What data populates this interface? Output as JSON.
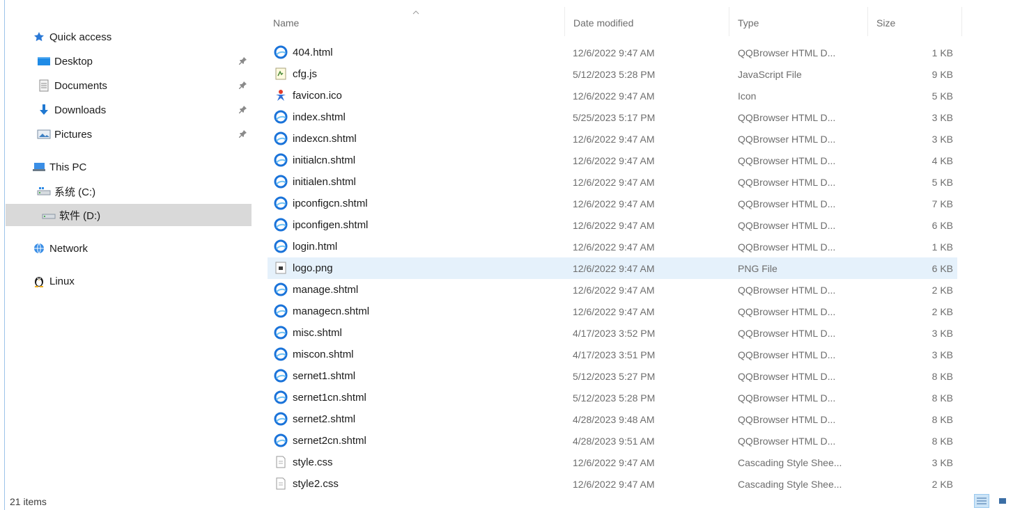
{
  "sidebar": {
    "quick_access": "Quick access",
    "items": [
      {
        "label": "Desktop",
        "icon": "desktop-icon"
      },
      {
        "label": "Documents",
        "icon": "documents-icon"
      },
      {
        "label": "Downloads",
        "icon": "downloads-icon"
      },
      {
        "label": "Pictures",
        "icon": "pictures-icon"
      }
    ],
    "this_pc": "This PC",
    "drive_c": "系统 (C:)",
    "drive_d": "软件 (D:)",
    "network": "Network",
    "linux": "Linux"
  },
  "columns": {
    "name": "Name",
    "date": "Date modified",
    "type": "Type",
    "size": "Size"
  },
  "files": [
    {
      "name": "404.html",
      "date": "12/6/2022 9:47 AM",
      "type": "QQBrowser HTML D...",
      "size": "1 KB",
      "icon": "qqbrowser-html-icon"
    },
    {
      "name": "cfg.js",
      "date": "5/12/2023 5:28 PM",
      "type": "JavaScript File",
      "size": "9 KB",
      "icon": "javascript-file-icon"
    },
    {
      "name": "favicon.ico",
      "date": "12/6/2022 9:47 AM",
      "type": "Icon",
      "size": "5 KB",
      "icon": "favicon-icon"
    },
    {
      "name": "index.shtml",
      "date": "5/25/2023 5:17 PM",
      "type": "QQBrowser HTML D...",
      "size": "3 KB",
      "icon": "qqbrowser-html-icon"
    },
    {
      "name": "indexcn.shtml",
      "date": "12/6/2022 9:47 AM",
      "type": "QQBrowser HTML D...",
      "size": "3 KB",
      "icon": "qqbrowser-html-icon"
    },
    {
      "name": "initialcn.shtml",
      "date": "12/6/2022 9:47 AM",
      "type": "QQBrowser HTML D...",
      "size": "4 KB",
      "icon": "qqbrowser-html-icon"
    },
    {
      "name": "initialen.shtml",
      "date": "12/6/2022 9:47 AM",
      "type": "QQBrowser HTML D...",
      "size": "5 KB",
      "icon": "qqbrowser-html-icon"
    },
    {
      "name": "ipconfigcn.shtml",
      "date": "12/6/2022 9:47 AM",
      "type": "QQBrowser HTML D...",
      "size": "7 KB",
      "icon": "qqbrowser-html-icon"
    },
    {
      "name": "ipconfigen.shtml",
      "date": "12/6/2022 9:47 AM",
      "type": "QQBrowser HTML D...",
      "size": "6 KB",
      "icon": "qqbrowser-html-icon"
    },
    {
      "name": "login.html",
      "date": "12/6/2022 9:47 AM",
      "type": "QQBrowser HTML D...",
      "size": "1 KB",
      "icon": "qqbrowser-html-icon"
    },
    {
      "name": "logo.png",
      "date": "12/6/2022 9:47 AM",
      "type": "PNG File",
      "size": "6 KB",
      "icon": "png-file-icon",
      "highlight": true
    },
    {
      "name": "manage.shtml",
      "date": "12/6/2022 9:47 AM",
      "type": "QQBrowser HTML D...",
      "size": "2 KB",
      "icon": "qqbrowser-html-icon"
    },
    {
      "name": "managecn.shtml",
      "date": "12/6/2022 9:47 AM",
      "type": "QQBrowser HTML D...",
      "size": "2 KB",
      "icon": "qqbrowser-html-icon"
    },
    {
      "name": "misc.shtml",
      "date": "4/17/2023 3:52 PM",
      "type": "QQBrowser HTML D...",
      "size": "3 KB",
      "icon": "qqbrowser-html-icon"
    },
    {
      "name": "miscon.shtml",
      "date": "4/17/2023 3:51 PM",
      "type": "QQBrowser HTML D...",
      "size": "3 KB",
      "icon": "qqbrowser-html-icon"
    },
    {
      "name": "sernet1.shtml",
      "date": "5/12/2023 5:27 PM",
      "type": "QQBrowser HTML D...",
      "size": "8 KB",
      "icon": "qqbrowser-html-icon"
    },
    {
      "name": "sernet1cn.shtml",
      "date": "5/12/2023 5:28 PM",
      "type": "QQBrowser HTML D...",
      "size": "8 KB",
      "icon": "qqbrowser-html-icon"
    },
    {
      "name": "sernet2.shtml",
      "date": "4/28/2023 9:48 AM",
      "type": "QQBrowser HTML D...",
      "size": "8 KB",
      "icon": "qqbrowser-html-icon"
    },
    {
      "name": "sernet2cn.shtml",
      "date": "4/28/2023 9:51 AM",
      "type": "QQBrowser HTML D...",
      "size": "8 KB",
      "icon": "qqbrowser-html-icon"
    },
    {
      "name": "style.css",
      "date": "12/6/2022 9:47 AM",
      "type": "Cascading Style Shee...",
      "size": "3 KB",
      "icon": "css-file-icon"
    },
    {
      "name": "style2.css",
      "date": "12/6/2022 9:47 AM",
      "type": "Cascading Style Shee...",
      "size": "2 KB",
      "icon": "css-file-icon"
    }
  ],
  "status": {
    "item_count": "21 items"
  },
  "colors": {
    "accent": "#0a64c8",
    "selected_nav": "#d9d9d9",
    "highlight_row": "#e5f1fb"
  }
}
